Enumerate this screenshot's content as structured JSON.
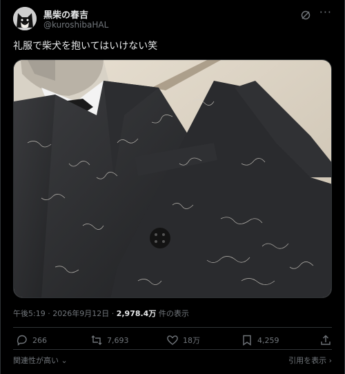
{
  "author": {
    "name": "黒柴の春吉",
    "handle": "@kuroshibaHAL"
  },
  "tweet": {
    "text": "礼服で柴犬を抱いてはいけない笑"
  },
  "meta": {
    "time": "午後5:19",
    "sep1": "·",
    "date": "2026年9月12日",
    "sep2": "·",
    "views_count": "2,978.4万",
    "views_label": "件の表示"
  },
  "actions": {
    "replies": "266",
    "reposts": "7,693",
    "likes": "18万",
    "bookmarks": "4,259"
  },
  "footer": {
    "relevance": "関連性が高い",
    "quotes": "引用を表示"
  },
  "icons": {
    "accent": "#e7e9ea",
    "muted": "#71767b"
  }
}
